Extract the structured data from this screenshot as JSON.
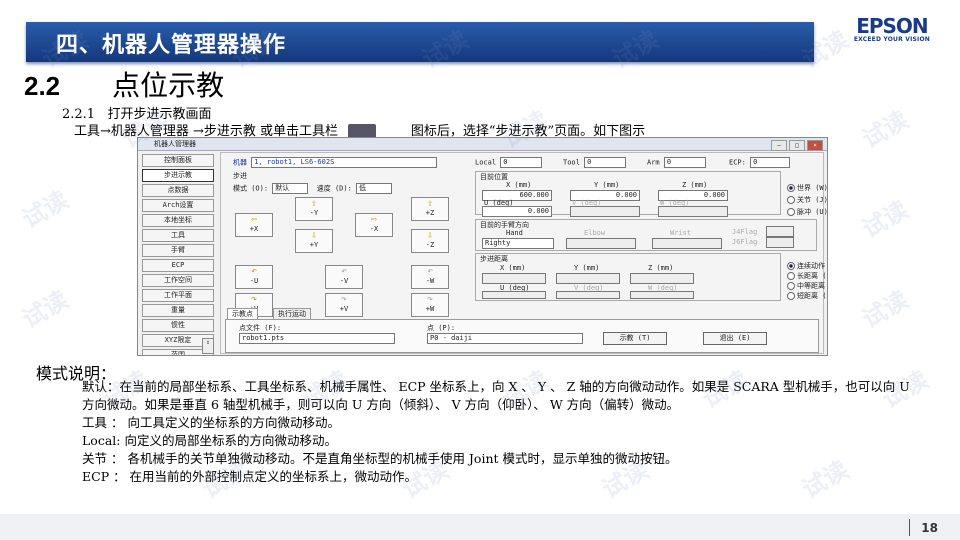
{
  "banner": {
    "title": "四、机器人管理器操作"
  },
  "logo": {
    "brand": "EPSON",
    "tagline": "EXCEED YOUR VISION"
  },
  "section": {
    "number": "2.2",
    "title": "点位示教"
  },
  "step": {
    "number": "2.2.1",
    "text": "打开步进示教画面"
  },
  "instruction": {
    "before": "工具→机器人管理器 →步进示教 或单击工具栏",
    "after": "图标后，选择“步进示教”页面。如下图示"
  },
  "window": {
    "title": "机器人管理器",
    "nav": [
      "控制面板",
      "步进示教",
      "点数据",
      "Arch设置",
      "本地坐标",
      "工具",
      "手臂",
      "ECP",
      "工作空间",
      "工作平面",
      "重量",
      "惯性",
      "XYZ限定",
      "范围"
    ],
    "selected_nav": "步进示教",
    "robot_label": "机器",
    "robot_value": "1, robot1, LS6-602S",
    "local_label": "Local",
    "local_value": "0",
    "tool_label": "Tool",
    "tool_value": "0",
    "arm_label": "Arm",
    "arm_value": "0",
    "ecp_label": "ECP:",
    "ecp_value": "0",
    "jog_group": "步进",
    "mode_label": "模式 (O):",
    "mode_value": "默认",
    "speed_label": "速度 (D):",
    "speed_value": "低",
    "jog_buttons": [
      "-Y",
      "+Z",
      "+X",
      "-X",
      "+Y",
      "-Z",
      "-U",
      "-V",
      "-W",
      "+U",
      "+V",
      "+W"
    ],
    "current_pos": "目前位置",
    "pos_headers": [
      "X (mm)",
      "Y (mm)",
      "Z (mm)"
    ],
    "pos_values": [
      "600.000",
      "0.000",
      "0.000"
    ],
    "uvw_headers": [
      "U (deg)",
      "V (deg)",
      "W (deg)"
    ],
    "uvw_values": [
      "0.000",
      "",
      ""
    ],
    "coord_options": [
      "世界 (W)",
      "关节 (J)",
      "脉冲 (U)"
    ],
    "arm_dir": "目前的手臂方向",
    "arm_headers": [
      "Hand",
      "Elbow",
      "Wrist"
    ],
    "hand_value": "Righty",
    "j4flag": "J4Flag",
    "j6flag": "J6Flag",
    "jog_dist": "步进距离",
    "dist_headers": [
      "X (mm)",
      "Y (mm)",
      "Z (mm)"
    ],
    "dist_headers2": [
      "U (deg)",
      "V (deg)",
      "W (deg)"
    ],
    "dist_options": [
      "连续动作 (C)",
      "长距离 (L)",
      "中等距离 (M)",
      "短距离 (S)"
    ],
    "tabs": [
      "示教点",
      "执行运动"
    ],
    "pointfile_label": "点文件 (F):",
    "pointfile_value": "robot1.pts",
    "point_label": "点 (P):",
    "point_value": "P0 - daiji",
    "teach_btn": "示教 (T)",
    "exit_btn": "退出 (E)"
  },
  "mode_title": "模式说明：",
  "paragraphs": [
    "默认：在当前的局部坐标系、工具坐标系、机械手属性、 ECP 坐标系上，向 X 、 Y 、 Z 轴的方向微动动作。如果是 SCARA 型机械手，也可以向 U 方向微动。如果是垂直 6 轴型机械手，则可以向 U 方向（倾斜）、 V 方向（仰卧）、 W 方向（偏转）微动。",
    "工具 ： 向工具定义的坐标系的方向微动移动。",
    "Local: 向定义的局部坐标系的方向微动移动。",
    "关节 ： 各机械手的关节单独微动移动。不是直角坐标型的机械手使用 Joint 模式时，显示单独的微动按钮。",
    "ECP ： 在用当前的外部控制点定义的坐标系上，微动动作。"
  ],
  "page_number": "18",
  "watermark": "试读"
}
